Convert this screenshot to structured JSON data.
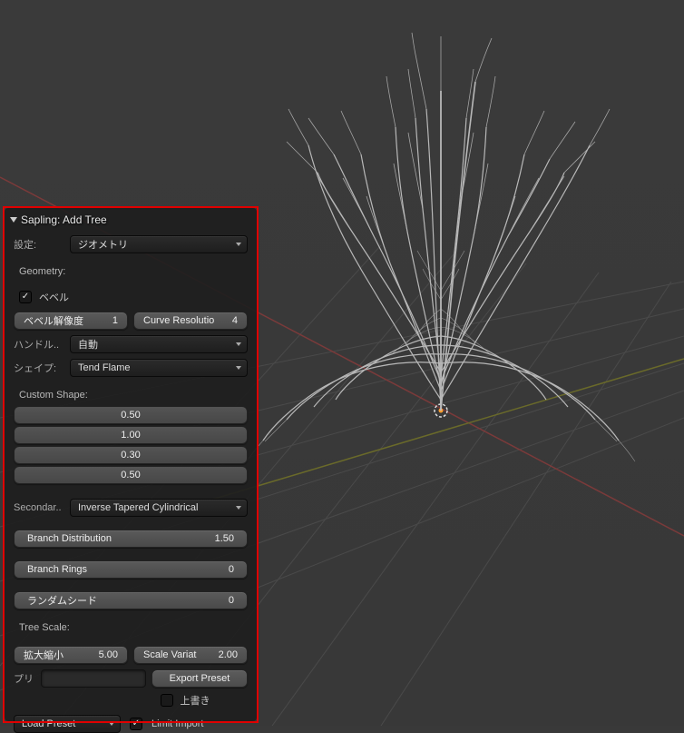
{
  "panel": {
    "title": "Sapling: Add Tree",
    "settings_label": "設定:",
    "settings_value": "ジオメトリ",
    "geometry_label": "Geometry:",
    "bevel_label": "ベベル",
    "bevel_res": {
      "label": "ベベル解像度",
      "value": "1"
    },
    "curve_res": {
      "label": "Curve Resolutio",
      "value": "4"
    },
    "handle_label": "ハンドル..",
    "handle_value": "自動",
    "shape_label": "シェイプ:",
    "shape_value": "Tend Flame",
    "custom_shape_label": "Custom Shape:",
    "custom_shape": [
      "0.50",
      "1.00",
      "0.30",
      "0.50"
    ],
    "secondary_label": "Secondar..",
    "secondary_value": "Inverse Tapered Cylindrical",
    "branch_dist": {
      "label": "Branch Distribution",
      "value": "1.50"
    },
    "branch_rings": {
      "label": "Branch Rings",
      "value": "0"
    },
    "random_seed": {
      "label": "ランダムシード",
      "value": "0"
    },
    "tree_scale_label": "Tree Scale:",
    "scale": {
      "label": "拡大縮小",
      "value": "5.00"
    },
    "scale_var": {
      "label": "Scale Variat",
      "value": "2.00"
    },
    "preset_label": "プリ",
    "export_preset": "Export Preset",
    "overwrite_label": "上書き",
    "load_preset": "Load Preset",
    "limit_import": "Limit Import"
  }
}
